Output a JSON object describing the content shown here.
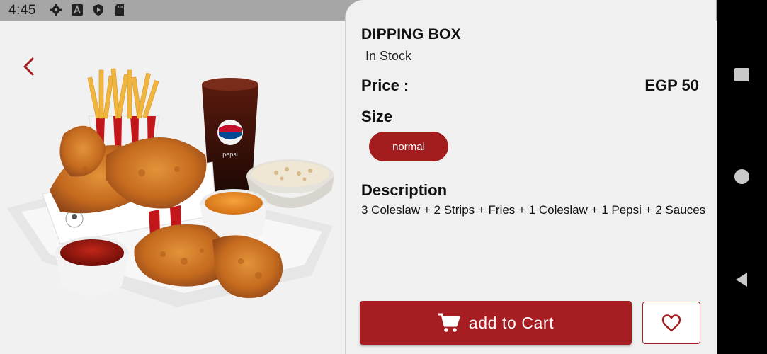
{
  "status_bar": {
    "time": "4:45",
    "left_icons": [
      "gear-icon",
      "a-badge-icon",
      "play-shield-icon",
      "sd-card-icon"
    ],
    "right_icons": [
      "wifi-icon",
      "signal-icon",
      "battery-icon"
    ]
  },
  "product": {
    "name": "DIPPING BOX",
    "stock": "In Stock",
    "price_label": "Price :",
    "price_value": "EGP 50",
    "size_label": "Size",
    "size_option": "normal",
    "description_label": "Description",
    "description": "3 Coleslaw + 2 Strips + Fries + 1 Coleslaw + 1 Pepsi + 2 Sauces"
  },
  "actions": {
    "add_to_cart": "add to Cart",
    "cart_icon": "cart-icon",
    "favorite_icon": "heart-icon"
  },
  "colors": {
    "accent": "#a31d1f",
    "status_bar": "#a6a6a6",
    "nav_bar": "#000000",
    "panel_bg": "#f0f0f0"
  }
}
